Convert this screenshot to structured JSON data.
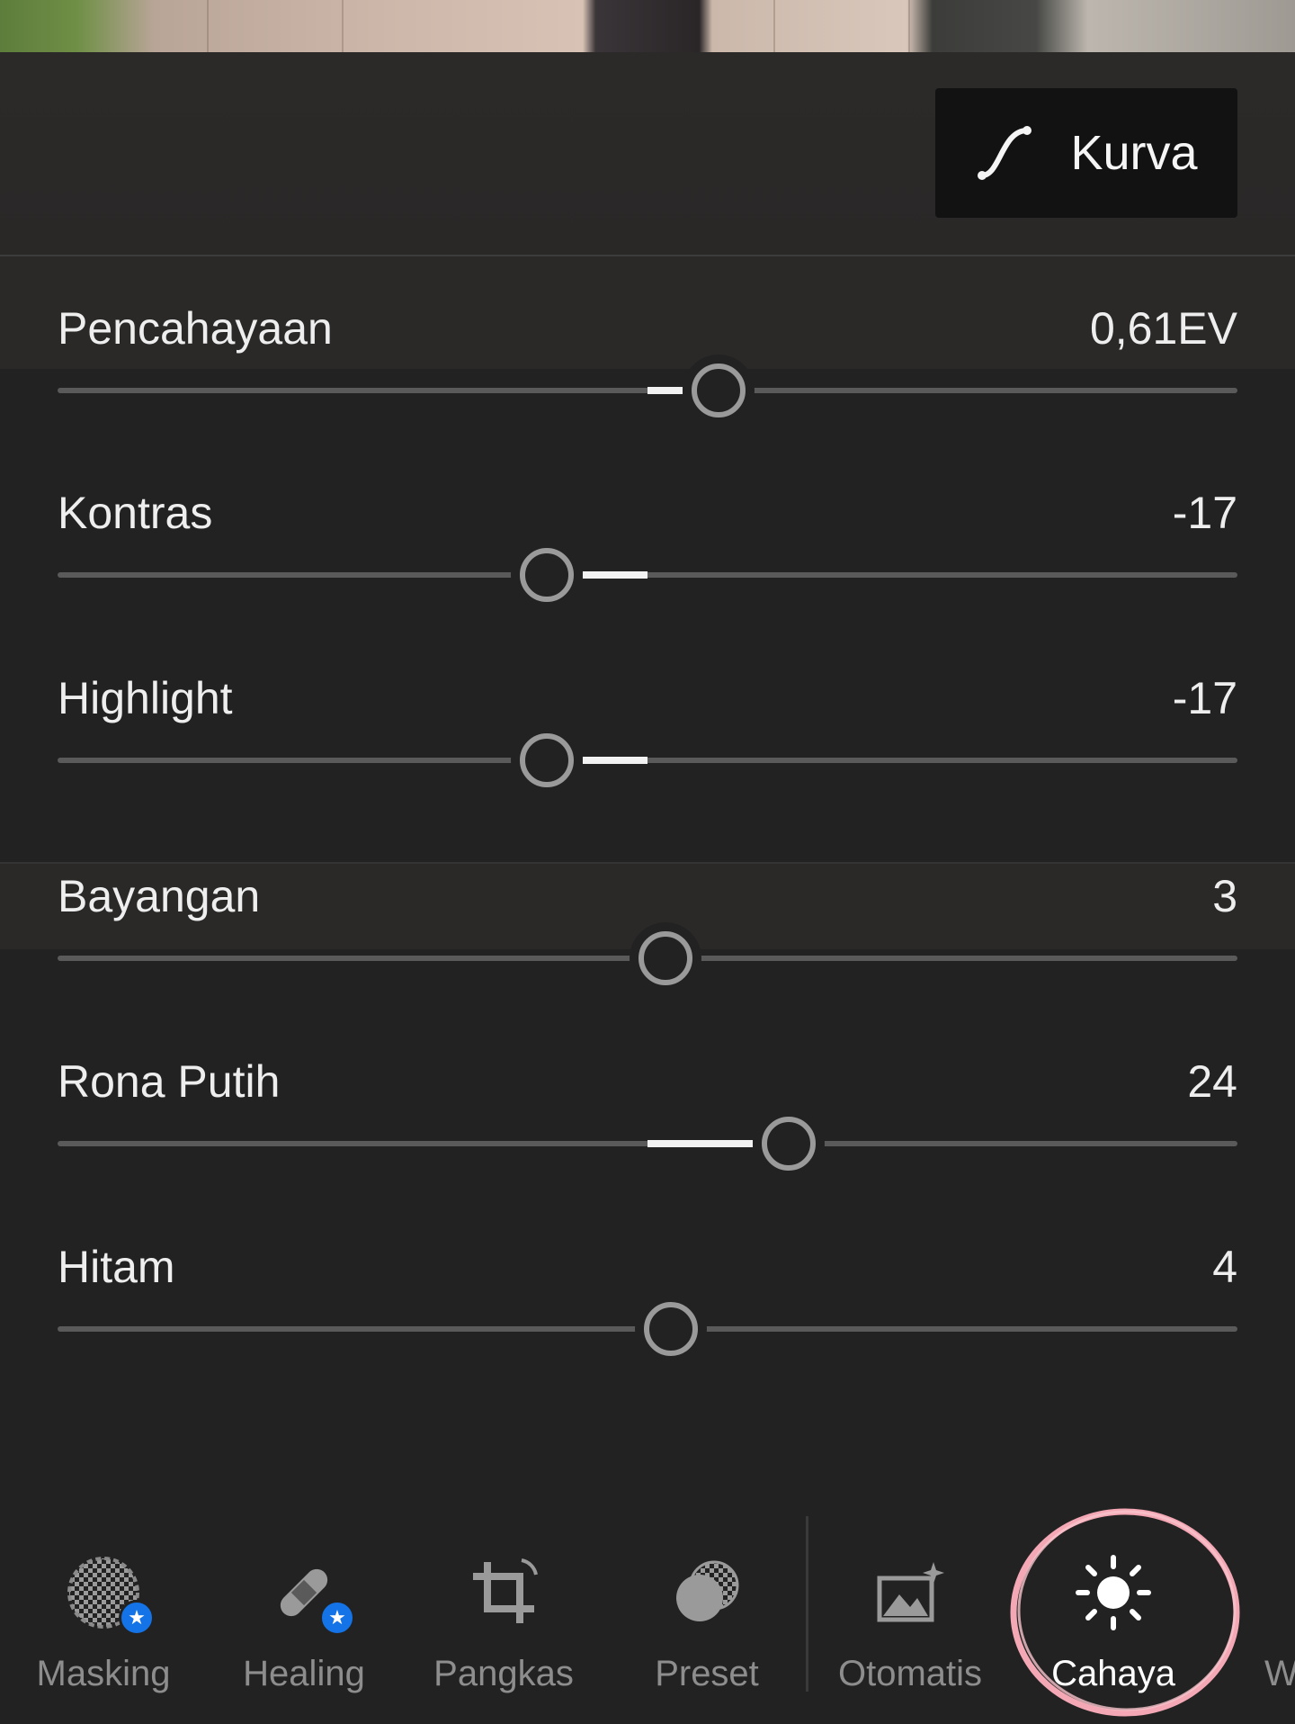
{
  "curve_button": {
    "label": "Kurva",
    "icon": "curve-icon"
  },
  "sliders": [
    {
      "name": "Pencahayaan",
      "value": "0,61EV",
      "level": 0.56,
      "center": 0.5
    },
    {
      "name": "Kontras",
      "value": "-17",
      "level": 0.415,
      "center": 0.5
    },
    {
      "name": "Highlight",
      "value": "-17",
      "level": 0.415,
      "center": 0.5
    },
    {
      "name": "Bayangan",
      "value": "3",
      "level": 0.515,
      "center": 0.5
    },
    {
      "name": "Rona Putih",
      "value": "24",
      "level": 0.62,
      "center": 0.5
    },
    {
      "name": "Hitam",
      "value": "4",
      "level": 0.52,
      "center": 0.5
    }
  ],
  "toolbar": {
    "items": [
      {
        "label": "Masking",
        "icon": "masking-icon",
        "premium": true,
        "active": false
      },
      {
        "label": "Healing",
        "icon": "healing-bandage-icon",
        "premium": true,
        "active": false
      },
      {
        "label": "Pangkas",
        "icon": "crop-icon",
        "premium": false,
        "active": false
      },
      {
        "label": "Preset",
        "icon": "preset-icon",
        "premium": false,
        "active": false
      },
      {
        "label": "Otomatis",
        "icon": "auto-image-icon",
        "premium": false,
        "active": false
      },
      {
        "label": "Cahaya",
        "icon": "sun-icon",
        "premium": false,
        "active": true
      },
      {
        "label": "W",
        "icon": "",
        "premium": false,
        "active": false
      }
    ],
    "premium_badge_icon": "star-icon"
  },
  "colors": {
    "background": "#222222",
    "track": "#5a5a5a",
    "fill": "#f2f2f2",
    "thumb": "#9a9a9a",
    "badge": "#1473e6",
    "highlight_ring": "#f4a7b4"
  }
}
